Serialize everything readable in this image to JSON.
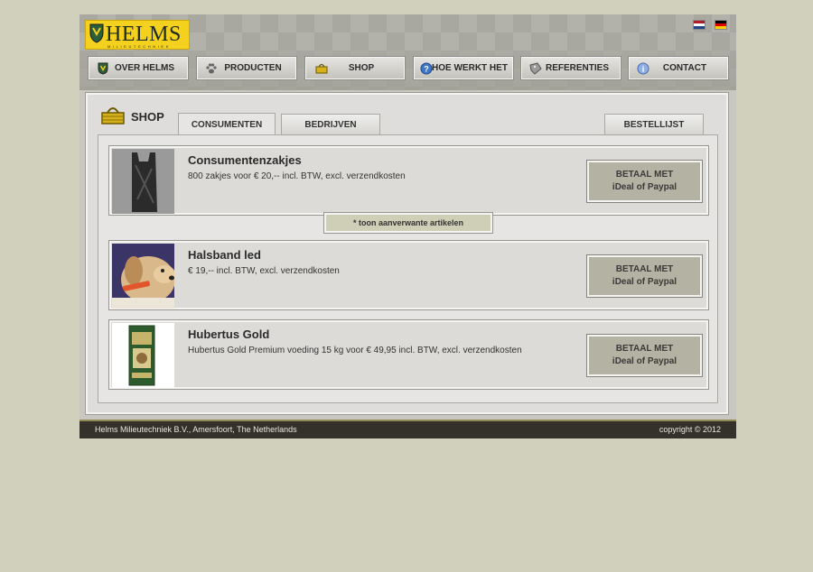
{
  "brand": {
    "logo_text": "HELMS",
    "logo_subtitle": "MILIEUTECHNIEK"
  },
  "languages": [
    {
      "code": "NL",
      "icon": "dutch-flag-icon"
    },
    {
      "code": "DE",
      "icon": "german-flag-icon"
    }
  ],
  "nav": {
    "items": [
      {
        "label": "OVER HELMS",
        "icon": "shield-icon"
      },
      {
        "label": "PRODUCTEN",
        "icon": "paw-icon"
      },
      {
        "label": "SHOP",
        "icon": "basket-icon"
      },
      {
        "label": "HOE WERKT HET",
        "icon": "question-icon"
      },
      {
        "label": "REFERENTIES",
        "icon": "tag-icon"
      },
      {
        "label": "CONTACT",
        "icon": "info-icon"
      }
    ]
  },
  "shop": {
    "title": "SHOP",
    "tabs": [
      {
        "label": "CONSUMENTEN",
        "active": true
      },
      {
        "label": "BEDRIJVEN",
        "active": false
      },
      {
        "label": "BESTELLIJST",
        "active": false
      }
    ],
    "related_label": "* toon aanverwante artikelen",
    "products": [
      {
        "name": "Consumentenzakjes",
        "description": "800 zakjes voor € 20,-- incl. BTW, excl. verzendkosten",
        "pay_line1": "BETAAL MET",
        "pay_line2": "iDeal of Paypal"
      },
      {
        "name": "Halsband led",
        "description": "€ 19,-- incl. BTW, excl. verzendkosten",
        "pay_line1": "BETAAL MET",
        "pay_line2": "iDeal of Paypal"
      },
      {
        "name": "Hubertus Gold",
        "description": "Hubertus Gold Premium voeding 15 kg voor € 49,95 incl. BTW, excl. verzendkosten",
        "pay_line1": "BETAAL MET",
        "pay_line2": "iDeal of Paypal"
      }
    ]
  },
  "footer": {
    "company": "Helms Milieutechniek B.V., Amersfoort, The Netherlands",
    "copyright": "copyright © 2012"
  },
  "colors": {
    "background": "#d1d0bd",
    "logo_yellow": "#f4d11f",
    "pay_button": "#b4b2a2",
    "footer": "#333129"
  }
}
